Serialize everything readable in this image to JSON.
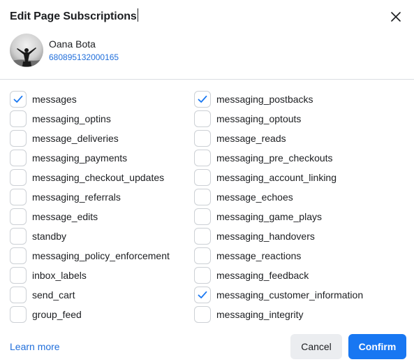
{
  "dialog": {
    "title": "Edit Page Subscriptions"
  },
  "page": {
    "name": "Oana Bota",
    "id": "680895132000165"
  },
  "subscriptions": {
    "left": [
      {
        "label": "messages",
        "checked": true
      },
      {
        "label": "messaging_optins",
        "checked": false
      },
      {
        "label": "message_deliveries",
        "checked": false
      },
      {
        "label": "messaging_payments",
        "checked": false
      },
      {
        "label": "messaging_checkout_updates",
        "checked": false
      },
      {
        "label": "messaging_referrals",
        "checked": false
      },
      {
        "label": "message_edits",
        "checked": false
      },
      {
        "label": "standby",
        "checked": false
      },
      {
        "label": "messaging_policy_enforcement",
        "checked": false
      },
      {
        "label": "inbox_labels",
        "checked": false
      },
      {
        "label": "send_cart",
        "checked": false
      },
      {
        "label": "group_feed",
        "checked": false
      }
    ],
    "right": [
      {
        "label": "messaging_postbacks",
        "checked": true
      },
      {
        "label": "messaging_optouts",
        "checked": false
      },
      {
        "label": "message_reads",
        "checked": false
      },
      {
        "label": "messaging_pre_checkouts",
        "checked": false
      },
      {
        "label": "messaging_account_linking",
        "checked": false
      },
      {
        "label": "message_echoes",
        "checked": false
      },
      {
        "label": "messaging_game_plays",
        "checked": false
      },
      {
        "label": "messaging_handovers",
        "checked": false
      },
      {
        "label": "message_reactions",
        "checked": false
      },
      {
        "label": "messaging_feedback",
        "checked": false
      },
      {
        "label": "messaging_customer_information",
        "checked": true
      },
      {
        "label": "messaging_integrity",
        "checked": false
      }
    ]
  },
  "footer": {
    "learn_more": "Learn more",
    "cancel": "Cancel",
    "confirm": "Confirm"
  },
  "colors": {
    "accent": "#1877f2",
    "link": "#216fdb",
    "checkmark": "#1877f2"
  },
  "icons": {
    "close": "close-icon",
    "check": "checkmark-icon"
  }
}
